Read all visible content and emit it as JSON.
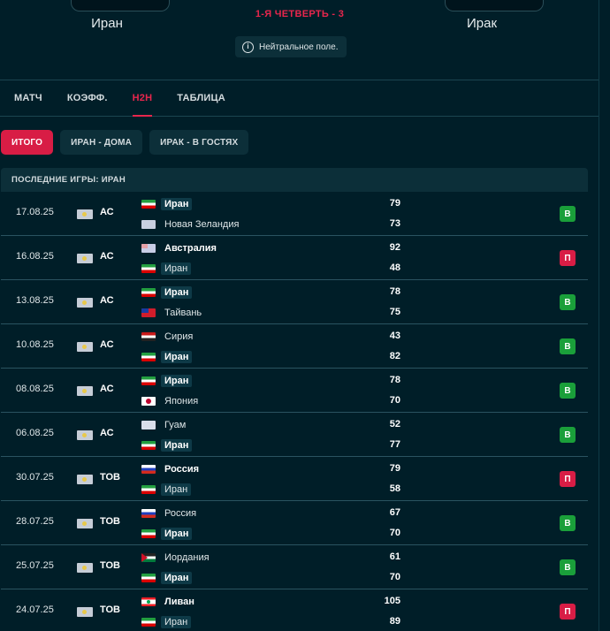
{
  "header": {
    "home_team": "Иран",
    "away_team": "Ирак",
    "status": "1-Я ЧЕТВЕРТЬ - 3",
    "venue": "Нейтральное поле."
  },
  "tabs": [
    {
      "label": "МАТЧ",
      "active": false
    },
    {
      "label": "КОЭФФ.",
      "active": false
    },
    {
      "label": "H2H",
      "active": true
    },
    {
      "label": "ТАБЛИЦА",
      "active": false
    }
  ],
  "filters": [
    {
      "label": "ИТОГО",
      "active": true
    },
    {
      "label": "ИРАН - ДОМА",
      "active": false
    },
    {
      "label": "ИРАК - В ГОСТЯХ",
      "active": false
    }
  ],
  "section_title": "ПОСЛЕДНИЕ ИГРЫ: ИРАН",
  "matches": [
    {
      "date": "17.08.25",
      "comp": "АС",
      "t1": "Иран",
      "f1": "iran",
      "b1": true,
      "h1": true,
      "s1": "79",
      "t2": "Новая Зеландия",
      "f2": "nz",
      "b2": false,
      "h2": false,
      "s2": "73",
      "result": "В",
      "win": true
    },
    {
      "date": "16.08.25",
      "comp": "АС",
      "t1": "Австралия",
      "f1": "aus",
      "b1": true,
      "h1": false,
      "s1": "92",
      "t2": "Иран",
      "f2": "iran",
      "b2": false,
      "h2": true,
      "s2": "48",
      "result": "П",
      "win": false
    },
    {
      "date": "13.08.25",
      "comp": "АС",
      "t1": "Иран",
      "f1": "iran",
      "b1": true,
      "h1": true,
      "s1": "78",
      "t2": "Тайвань",
      "f2": "twn",
      "b2": false,
      "h2": false,
      "s2": "75",
      "result": "В",
      "win": true
    },
    {
      "date": "10.08.25",
      "comp": "АС",
      "t1": "Сирия",
      "f1": "syr",
      "b1": false,
      "h1": false,
      "s1": "43",
      "t2": "Иран",
      "f2": "iran",
      "b2": true,
      "h2": true,
      "s2": "82",
      "result": "В",
      "win": true
    },
    {
      "date": "08.08.25",
      "comp": "АС",
      "t1": "Иран",
      "f1": "iran",
      "b1": true,
      "h1": true,
      "s1": "78",
      "t2": "Япония",
      "f2": "jpn",
      "b2": false,
      "h2": false,
      "s2": "70",
      "result": "В",
      "win": true
    },
    {
      "date": "06.08.25",
      "comp": "АС",
      "t1": "Гуам",
      "f1": "gum",
      "b1": false,
      "h1": false,
      "s1": "52",
      "t2": "Иран",
      "f2": "iran",
      "b2": true,
      "h2": true,
      "s2": "77",
      "result": "В",
      "win": true
    },
    {
      "date": "30.07.25",
      "comp": "ТОВ",
      "t1": "Россия",
      "f1": "rus",
      "b1": true,
      "h1": false,
      "s1": "79",
      "t2": "Иран",
      "f2": "iran",
      "b2": false,
      "h2": true,
      "s2": "58",
      "result": "П",
      "win": false
    },
    {
      "date": "28.07.25",
      "comp": "ТОВ",
      "t1": "Россия",
      "f1": "rus",
      "b1": false,
      "h1": false,
      "s1": "67",
      "t2": "Иран",
      "f2": "iran",
      "b2": true,
      "h2": true,
      "s2": "70",
      "result": "В",
      "win": true
    },
    {
      "date": "25.07.25",
      "comp": "ТОВ",
      "t1": "Иордания",
      "f1": "jor",
      "b1": false,
      "h1": false,
      "s1": "61",
      "t2": "Иран",
      "f2": "iran",
      "b2": true,
      "h2": true,
      "s2": "70",
      "result": "В",
      "win": true
    },
    {
      "date": "24.07.25",
      "comp": "ТОВ",
      "t1": "Ливан",
      "f1": "lbn",
      "b1": true,
      "h1": false,
      "s1": "105",
      "t2": "Иран",
      "f2": "iran",
      "b2": false,
      "h2": true,
      "s2": "89",
      "result": "П",
      "win": false
    }
  ],
  "colors": {
    "accent": "#e8264d",
    "win": "#1a9f3a",
    "loss": "#d81d45",
    "background": "#001e28"
  }
}
